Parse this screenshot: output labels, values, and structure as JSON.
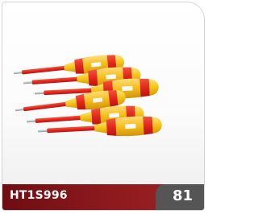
{
  "product": {
    "code": "HT1S996",
    "page": "81",
    "image_subject": "screwdriver-set"
  },
  "colors": {
    "handle_red": "#e0241b",
    "handle_yellow": "#f6c51a",
    "shaft_gray": "#b9bcc0",
    "footer_red": "#8e1a1e",
    "tab_gray": "#555555"
  }
}
